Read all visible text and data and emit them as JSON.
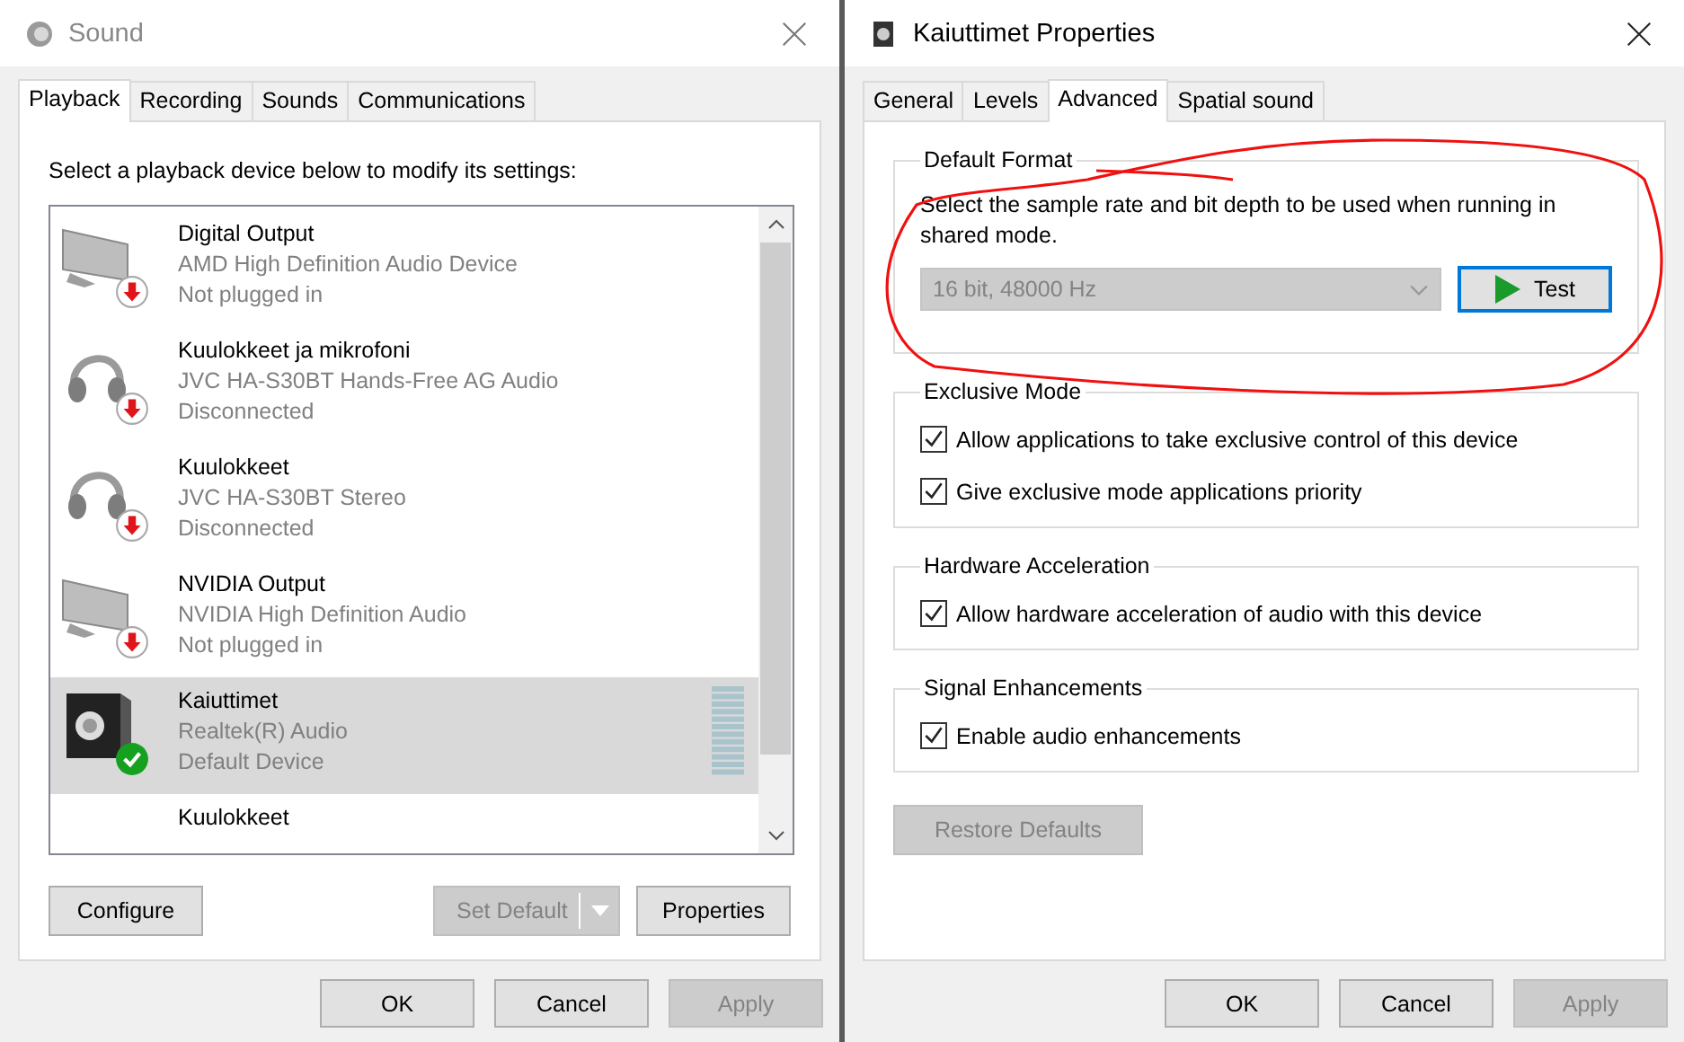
{
  "sound_window": {
    "title": "Sound",
    "tabs": [
      {
        "label": "Playback",
        "selected": true
      },
      {
        "label": "Recording",
        "selected": false
      },
      {
        "label": "Sounds",
        "selected": false
      },
      {
        "label": "Communications",
        "selected": false
      }
    ],
    "instruction": "Select a playback device below to modify its settings:",
    "devices": [
      {
        "name": "Digital Output",
        "driver": "AMD High Definition Audio Device",
        "status": "Not plugged in",
        "kind": "monitor",
        "default": false,
        "selected": false
      },
      {
        "name": "Kuulokkeet ja mikrofoni",
        "driver": "JVC HA-S30BT Hands-Free AG Audio",
        "status": "Disconnected",
        "kind": "headset",
        "default": false,
        "selected": false
      },
      {
        "name": "Kuulokkeet",
        "driver": "JVC HA-S30BT Stereo",
        "status": "Disconnected",
        "kind": "headset",
        "default": false,
        "selected": false
      },
      {
        "name": "NVIDIA Output",
        "driver": "NVIDIA High Definition Audio",
        "status": "Not plugged in",
        "kind": "monitor",
        "default": false,
        "selected": false
      },
      {
        "name": "Kaiuttimet",
        "driver": "Realtek(R) Audio",
        "status": "Default Device",
        "kind": "speaker",
        "default": true,
        "selected": true
      },
      {
        "name": "Kuulokkeet",
        "selected": false
      }
    ],
    "list_buttons": [
      {
        "label": "Configure",
        "disabled": false
      },
      {
        "label": "Set Default",
        "disabled": true,
        "split": true
      },
      {
        "label": "Properties",
        "disabled": false
      }
    ],
    "buttons": [
      {
        "label": "OK",
        "disabled": false
      },
      {
        "label": "Cancel",
        "disabled": false
      },
      {
        "label": "Apply",
        "disabled": true
      }
    ]
  },
  "properties_window": {
    "title": "Kaiuttimet Properties",
    "tabs": [
      {
        "label": "General",
        "selected": false
      },
      {
        "label": "Levels",
        "selected": false
      },
      {
        "label": "Advanced",
        "selected": true
      },
      {
        "label": "Spatial sound",
        "selected": false
      }
    ],
    "default_format": {
      "legend": "Default Format",
      "description": "Select the sample rate and bit depth to be used when running in shared mode.",
      "format": {
        "value": "16 bit, 48000 Hz",
        "disabled": true
      },
      "test_button": "Test"
    },
    "groups": [
      {
        "legend": "Exclusive Mode",
        "options": [
          {
            "label": "Allow applications to take exclusive control of this device",
            "checked": true
          },
          {
            "label": "Give exclusive mode applications priority",
            "checked": true
          }
        ]
      },
      {
        "legend": "Hardware Acceleration",
        "options": [
          {
            "label": "Allow hardware acceleration of audio with this device",
            "checked": true
          }
        ]
      },
      {
        "legend": "Signal Enhancements",
        "options": [
          {
            "label": "Enable audio enhancements",
            "checked": true
          }
        ]
      }
    ],
    "restore_button": {
      "label": "Restore Defaults",
      "disabled": true
    },
    "buttons": [
      {
        "label": "OK",
        "disabled": false
      },
      {
        "label": "Cancel",
        "disabled": false
      },
      {
        "label": "Apply",
        "disabled": true
      }
    ]
  }
}
